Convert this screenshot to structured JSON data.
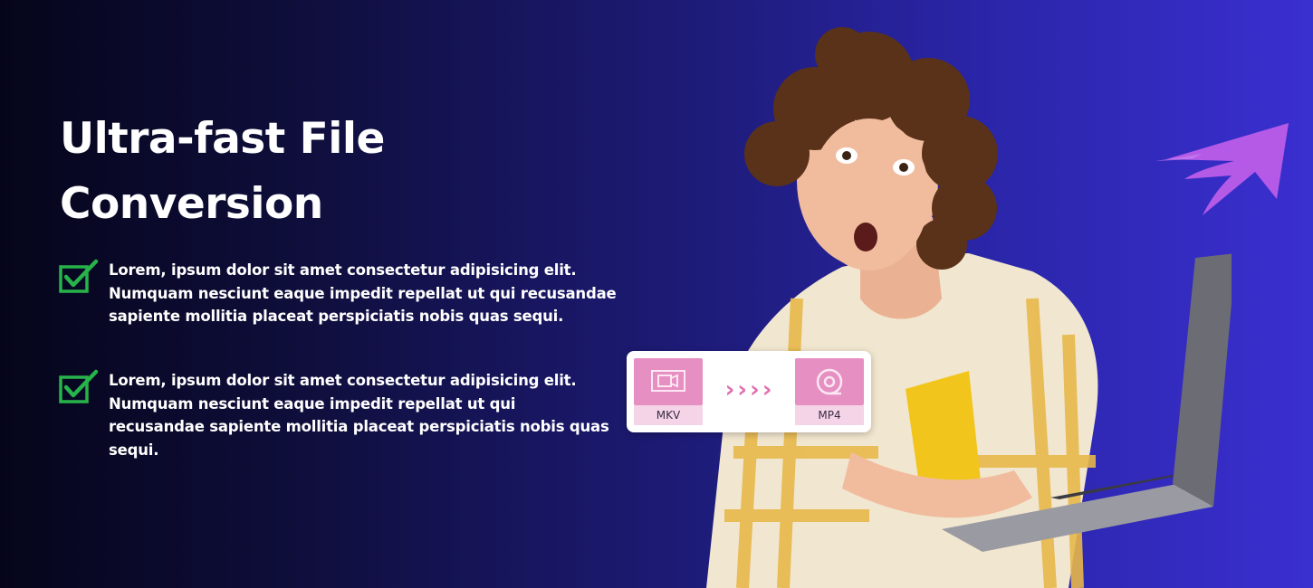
{
  "hero": {
    "headline": "Ultra-fast File Conversion"
  },
  "features": [
    {
      "text": "Lorem, ipsum dolor sit amet consectetur adipisicing elit. Numquam nesciunt eaque impedit repellat ut qui recusandae sapiente mollitia placeat perspiciatis nobis quas sequi.",
      "icon": "check-icon"
    },
    {
      "text": "Lorem, ipsum dolor sit amet consectetur adipisicing elit. Numquam nesciunt eaque impedit repellat ut qui recusandae sapiente mollitia placeat perspiciatis nobis quas sequi.",
      "icon": "check-icon"
    }
  ],
  "converter": {
    "source_format": "MKV",
    "target_format": "MP4",
    "source_icon": "video-file-icon",
    "target_icon": "disc-icon",
    "arrow_glyphs": "››››"
  },
  "colors": {
    "check": "#27b34a",
    "tile": "#e68fc2",
    "arrow": "#b45ae6"
  }
}
